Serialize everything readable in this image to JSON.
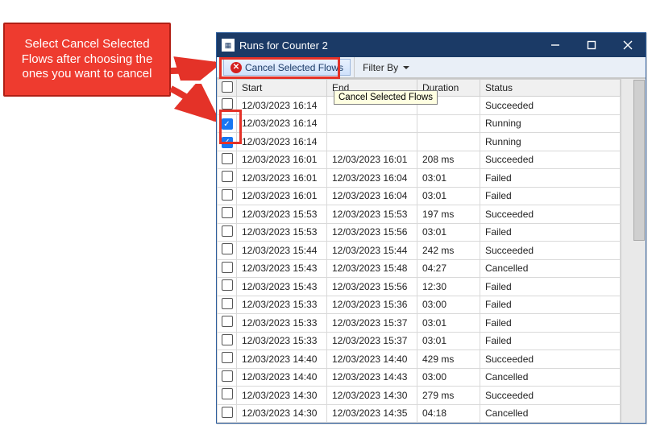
{
  "callout": {
    "text": "Select Cancel Selected Flows after choosing the ones you want to cancel"
  },
  "window": {
    "title": "Runs for Counter 2"
  },
  "toolbar": {
    "cancel_label": "Cancel Selected Flows",
    "filter_label": "Filter By"
  },
  "tooltip": {
    "text": "Cancel Selected Flows"
  },
  "columns": {
    "start": "Start",
    "end": "End",
    "duration": "Duration",
    "status": "Status"
  },
  "rows": [
    {
      "checked": false,
      "start": "12/03/2023 16:14",
      "end": "",
      "duration": "",
      "status": "Succeeded"
    },
    {
      "checked": true,
      "start": "12/03/2023 16:14",
      "end": "",
      "duration": "",
      "status": "Running"
    },
    {
      "checked": true,
      "start": "12/03/2023 16:14",
      "end": "",
      "duration": "",
      "status": "Running"
    },
    {
      "checked": false,
      "start": "12/03/2023 16:01",
      "end": "12/03/2023 16:01",
      "duration": "208 ms",
      "status": "Succeeded"
    },
    {
      "checked": false,
      "start": "12/03/2023 16:01",
      "end": "12/03/2023 16:04",
      "duration": "03:01",
      "status": "Failed"
    },
    {
      "checked": false,
      "start": "12/03/2023 16:01",
      "end": "12/03/2023 16:04",
      "duration": "03:01",
      "status": "Failed"
    },
    {
      "checked": false,
      "start": "12/03/2023 15:53",
      "end": "12/03/2023 15:53",
      "duration": "197 ms",
      "status": "Succeeded"
    },
    {
      "checked": false,
      "start": "12/03/2023 15:53",
      "end": "12/03/2023 15:56",
      "duration": "03:01",
      "status": "Failed"
    },
    {
      "checked": false,
      "start": "12/03/2023 15:44",
      "end": "12/03/2023 15:44",
      "duration": "242 ms",
      "status": "Succeeded"
    },
    {
      "checked": false,
      "start": "12/03/2023 15:43",
      "end": "12/03/2023 15:48",
      "duration": "04:27",
      "status": "Cancelled"
    },
    {
      "checked": false,
      "start": "12/03/2023 15:43",
      "end": "12/03/2023 15:56",
      "duration": "12:30",
      "status": "Failed"
    },
    {
      "checked": false,
      "start": "12/03/2023 15:33",
      "end": "12/03/2023 15:36",
      "duration": "03:00",
      "status": "Failed"
    },
    {
      "checked": false,
      "start": "12/03/2023 15:33",
      "end": "12/03/2023 15:37",
      "duration": "03:01",
      "status": "Failed"
    },
    {
      "checked": false,
      "start": "12/03/2023 15:33",
      "end": "12/03/2023 15:37",
      "duration": "03:01",
      "status": "Failed"
    },
    {
      "checked": false,
      "start": "12/03/2023 14:40",
      "end": "12/03/2023 14:40",
      "duration": "429 ms",
      "status": "Succeeded"
    },
    {
      "checked": false,
      "start": "12/03/2023 14:40",
      "end": "12/03/2023 14:43",
      "duration": "03:00",
      "status": "Cancelled"
    },
    {
      "checked": false,
      "start": "12/03/2023 14:30",
      "end": "12/03/2023 14:30",
      "duration": "279 ms",
      "status": "Succeeded"
    },
    {
      "checked": false,
      "start": "12/03/2023 14:30",
      "end": "12/03/2023 14:35",
      "duration": "04:18",
      "status": "Cancelled"
    }
  ]
}
